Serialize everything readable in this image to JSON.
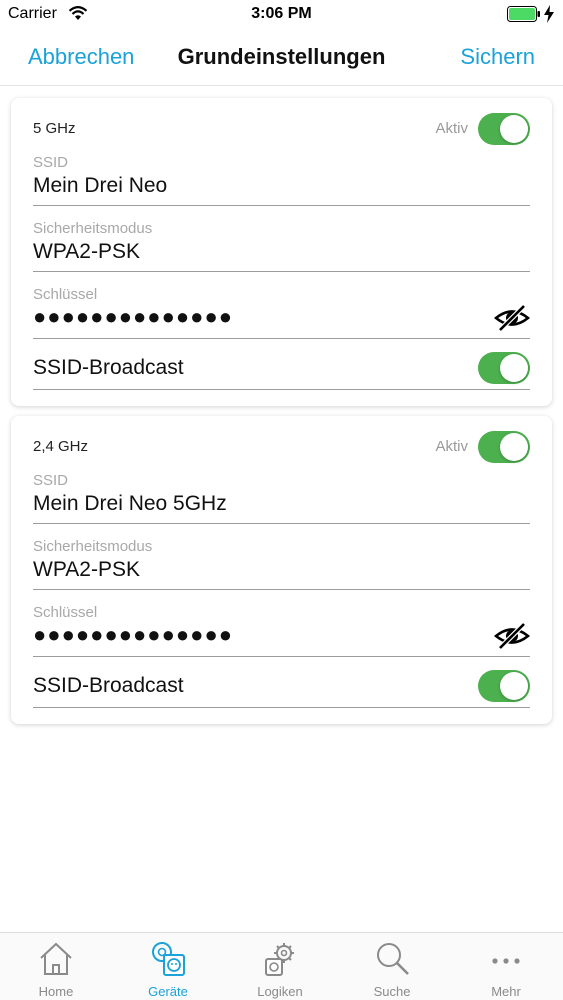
{
  "status_bar": {
    "carrier": "Carrier",
    "time": "3:06 PM",
    "battery_color": "#4cd964"
  },
  "nav": {
    "cancel_label": "Abbrechen",
    "title": "Grundeinstellungen",
    "save_label": "Sichern",
    "accent_color": "#1aa2d9"
  },
  "networks": [
    {
      "band": "5 GHz",
      "active_label": "Aktiv",
      "active": true,
      "ssid_label": "SSID",
      "ssid": "Mein Drei Neo",
      "security_label": "Sicherheitsmodus",
      "security": "WPA2-PSK",
      "key_label": "Schlüssel",
      "key_masked": "●●●●●●●●●●●●●●",
      "broadcast_label": "SSID-Broadcast",
      "broadcast": true
    },
    {
      "band": "2,4 GHz",
      "active_label": "Aktiv",
      "active": true,
      "ssid_label": "SSID",
      "ssid": "Mein Drei Neo 5GHz",
      "security_label": "Sicherheitsmodus",
      "security": "WPA2-PSK",
      "key_label": "Schlüssel",
      "key_masked": "●●●●●●●●●●●●●●",
      "broadcast_label": "SSID-Broadcast",
      "broadcast": true
    }
  ],
  "toggle_on_color": "#4db04f",
  "tabs": [
    {
      "label": "Home",
      "icon": "home-icon",
      "active": false
    },
    {
      "label": "Geräte",
      "icon": "devices-icon",
      "active": true
    },
    {
      "label": "Logiken",
      "icon": "logic-gear-icon",
      "active": false
    },
    {
      "label": "Suche",
      "icon": "search-icon",
      "active": false
    },
    {
      "label": "Mehr",
      "icon": "more-icon",
      "active": false
    }
  ]
}
